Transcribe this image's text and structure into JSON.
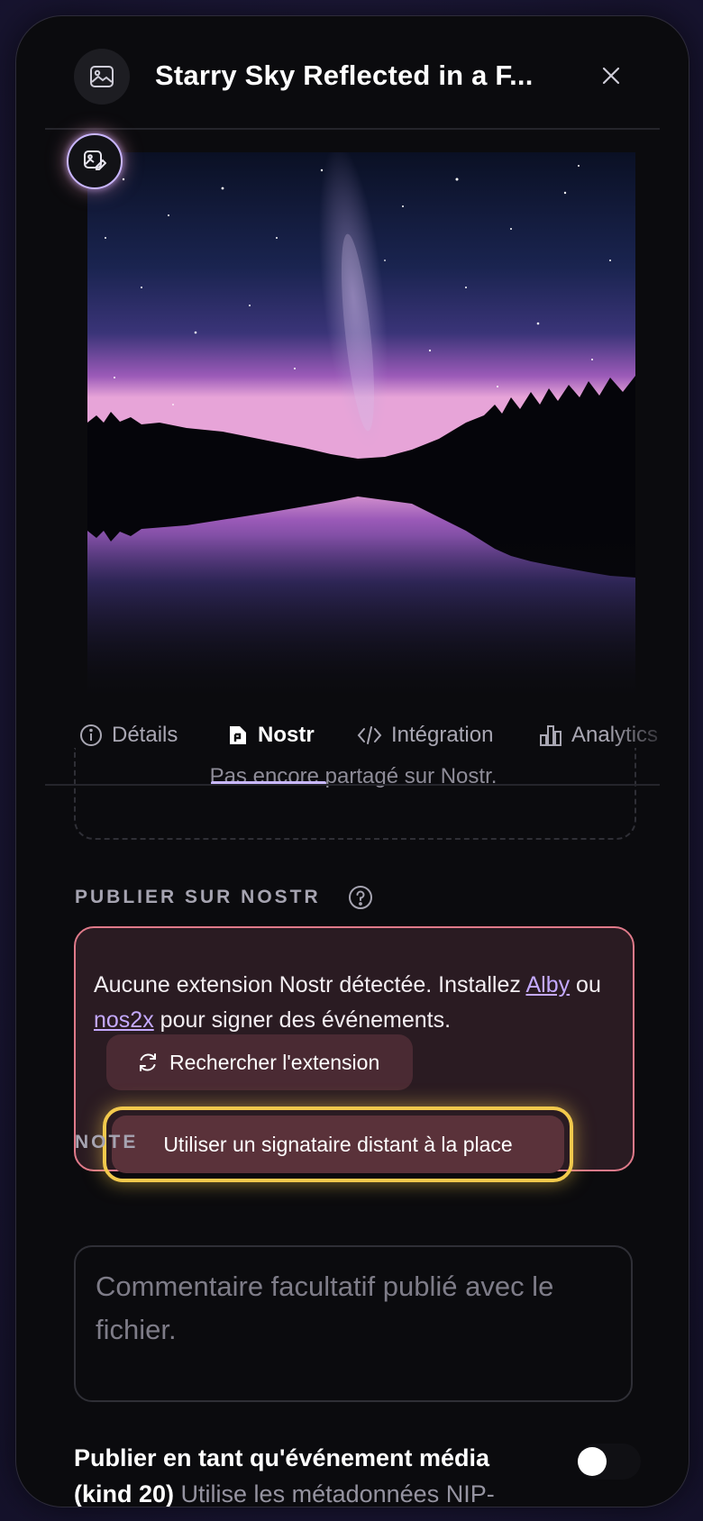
{
  "header": {
    "title": "Starry Sky Reflected in a F...",
    "icon": "image-icon",
    "close_icon": "close-icon"
  },
  "badge": {
    "icon": "image-edit-icon"
  },
  "tabs": [
    {
      "label": "Détails",
      "icon": "info-icon"
    },
    {
      "label": "Nostr",
      "icon": "nostr-icon",
      "active": true
    },
    {
      "label": "Intégration",
      "icon": "code-icon"
    },
    {
      "label": "Analytics",
      "icon": "bar-chart-icon"
    }
  ],
  "share_status": "Pas encore partagé sur Nostr.",
  "publish": {
    "section_label": "PUBLIER SUR NOSTR",
    "alert": {
      "text_before": "Aucune extension Nostr détectée. Installez ",
      "link1": "Alby",
      "text_middle": " ou ",
      "link2": "nos2x",
      "text_after": " pour signer des événements.",
      "check_button": "Rechercher l'extension",
      "remote_button": "Utiliser un signataire distant à la place"
    }
  },
  "note": {
    "label": "NOTE",
    "placeholder": "Commentaire facultatif publié avec le fichier."
  },
  "media_event": {
    "title": "Publier en tant qu'événement média (kind 20)",
    "subtitle": "Utilise les métadonnées NIP-",
    "enabled": false
  },
  "colors": {
    "accent": "#c9b8ff",
    "link": "#c4a9ff",
    "alert_border": "#e07a8a",
    "highlight": "#f2c94c"
  }
}
